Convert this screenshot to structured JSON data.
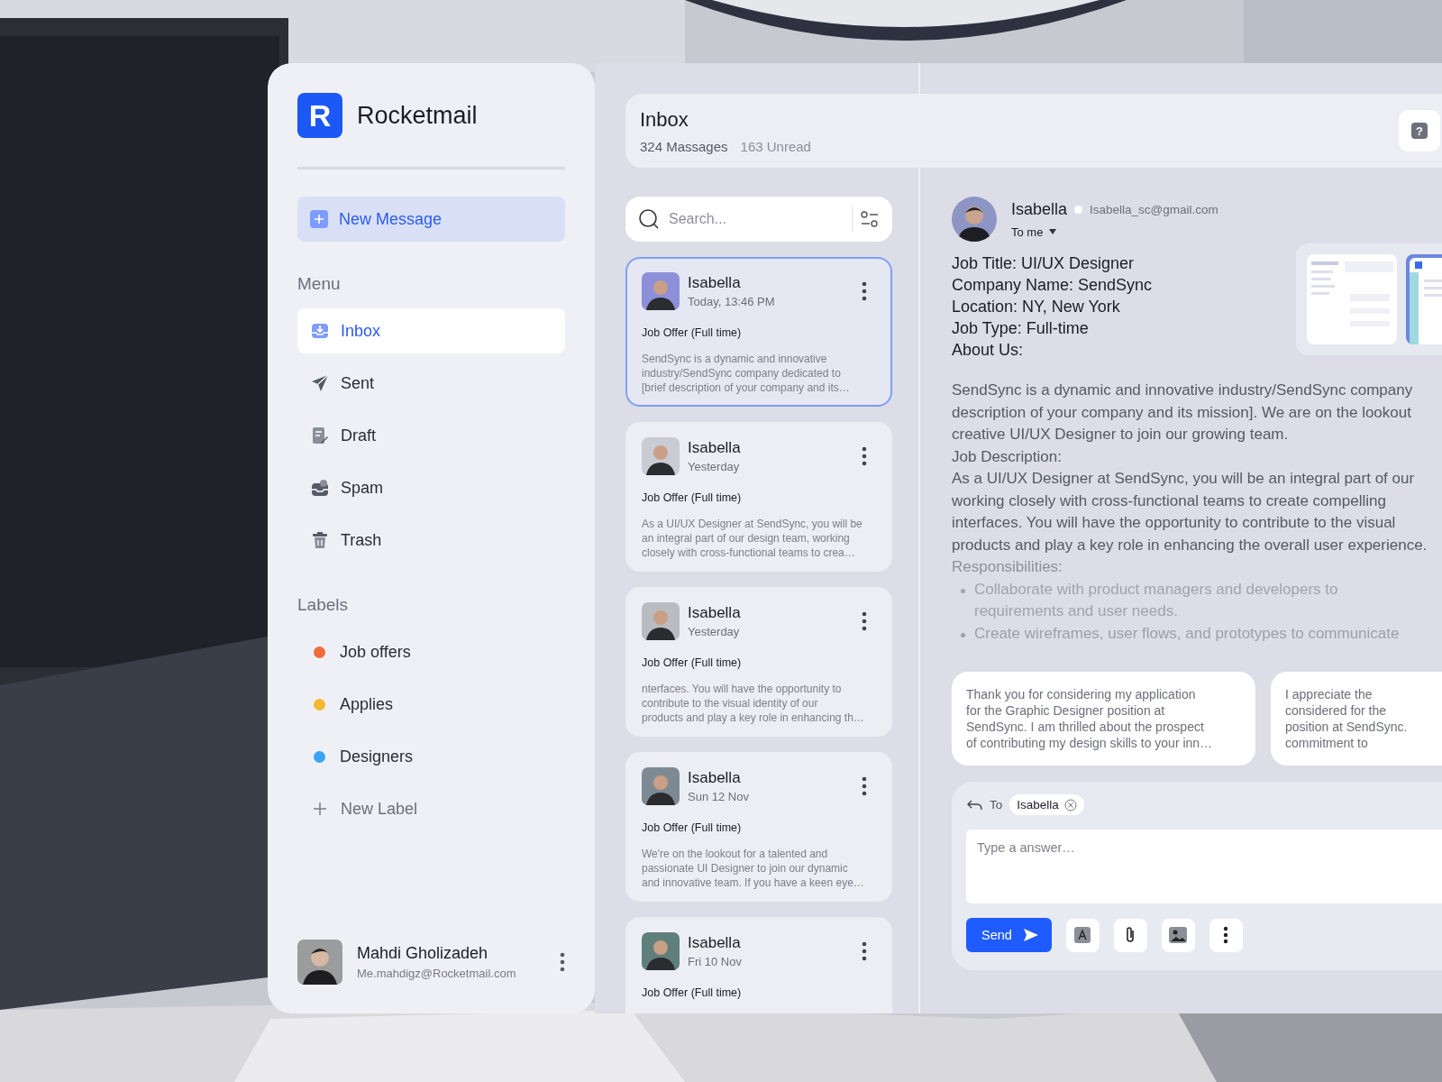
{
  "app": {
    "logo_letter": "R",
    "name": "Rocketmail"
  },
  "sidebar": {
    "new_message": "New Message",
    "menu_heading": "Menu",
    "menu": [
      {
        "label": "Inbox",
        "kind": "inbox",
        "selected": true
      },
      {
        "label": "Sent",
        "kind": "sent",
        "selected": false
      },
      {
        "label": "Draft",
        "kind": "draft",
        "selected": false
      },
      {
        "label": "Spam",
        "kind": "spam",
        "selected": false
      },
      {
        "label": "Trash",
        "kind": "trash",
        "selected": false
      }
    ],
    "labels_heading": "Labels",
    "labels": [
      {
        "label": "Job offers",
        "color": "#f26b3a"
      },
      {
        "label": "Applies",
        "color": "#f5b731"
      },
      {
        "label": "Designers",
        "color": "#3aa3f5"
      }
    ],
    "new_label": "New Label",
    "user": {
      "name": "Mahdi Gholizadeh",
      "email": "Me.mahdigz@Rocketmail.com"
    }
  },
  "header": {
    "title": "Inbox",
    "messages": "324 Massages",
    "unread": "163 Unread",
    "help": "?"
  },
  "search": {
    "placeholder": "Search..."
  },
  "messages": [
    {
      "sender": "Isabella",
      "time": "Today, 13:46 PM",
      "subject": "Job Offer (Full time)",
      "preview": [
        "SendSync is a dynamic and innovative",
        "industry/SendSync company dedicated to",
        "[brief description of your company and its…"
      ],
      "selected": true
    },
    {
      "sender": "Isabella",
      "time": "Yesterday",
      "subject": "Job Offer (Full time)",
      "preview": [
        "As a UI/UX Designer at SendSync, you will be",
        "an integral part of our design team, working",
        "closely with cross-functional teams to crea…"
      ],
      "selected": false
    },
    {
      "sender": "Isabella",
      "time": "Yesterday",
      "subject": "Job Offer (Full time)",
      "preview": [
        "nterfaces. You will have the opportunity to",
        "contribute to the visual identity of our",
        "products and play a key role in enhancing th…"
      ],
      "selected": false
    },
    {
      "sender": "Isabella",
      "time": "Sun 12 Nov",
      "subject": "Job Offer (Full time)",
      "preview": [
        "We're on the lookout for a talented and",
        "passionate UI Designer to join our dynamic",
        "and innovative team. If you have a keen eye…"
      ],
      "selected": false
    },
    {
      "sender": "Isabella",
      "time": "Fri 10 Nov",
      "subject": "Job Offer (Full time)",
      "selected": false
    }
  ],
  "detail": {
    "sender": "Isabella",
    "email": "Isabella_sc@gmail.com",
    "recipient": "To me",
    "fields": [
      "Job Title: UI/UX Designer",
      "Company Name: SendSync",
      "Location: NY, New York",
      "Job Type: Full-time",
      "About Us:"
    ],
    "about": [
      "SendSync is a dynamic and innovative industry/SendSync company",
      "description of your company and its mission]. We are on the lookout",
      "creative UI/UX Designer to join our growing team."
    ],
    "description_heading": "Job Description:",
    "description": [
      "As a UI/UX Designer at SendSync, you will be an integral part of our",
      "working closely with cross-functional teams to create compelling",
      "interfaces. You will have the opportunity to contribute to the visual",
      "products and play a key role in enhancing the overall user experience."
    ],
    "responsibilities_heading": "Responsibilities:",
    "responsibilities": [
      [
        "Collaborate with product managers and developers to",
        "requirements and user needs."
      ],
      [
        "Create wireframes, user flows, and prototypes to communicate"
      ]
    ]
  },
  "suggestions": [
    [
      "Thank you for considering my application",
      "for the Graphic Designer position at",
      "SendSync. I am thrilled about the prospect",
      "of contributing my design skills to your inn…"
    ],
    [
      "I appreciate the",
      "considered for the",
      "position at SendSync.",
      "commitment to"
    ]
  ],
  "compose": {
    "to_label": "To",
    "recipient": "Isabella",
    "placeholder": "Type a answer…",
    "send": "Send"
  }
}
